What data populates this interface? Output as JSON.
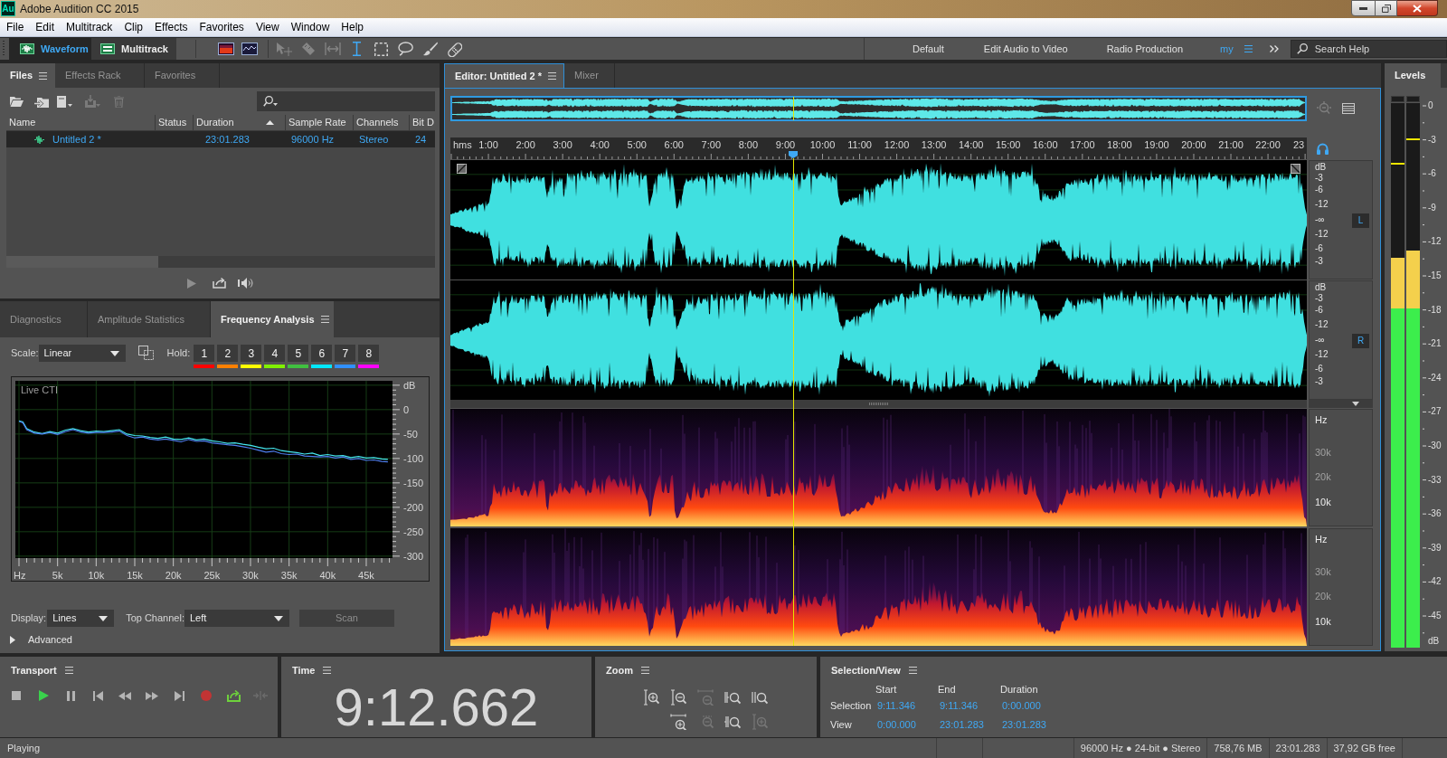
{
  "window": {
    "app_icon": "Au",
    "title": "Adobe Audition CC 2015"
  },
  "menu": [
    "File",
    "Edit",
    "Multitrack",
    "Clip",
    "Effects",
    "Favorites",
    "View",
    "Window",
    "Help"
  ],
  "toolbar": {
    "modes": [
      {
        "label": "Waveform",
        "selected": true
      },
      {
        "label": "Multitrack",
        "selected": false
      }
    ],
    "tools": [
      {
        "selected": false,
        "disabled": true
      },
      {
        "selected": false,
        "disabled": true
      },
      {
        "selected": false,
        "disabled": true
      },
      {
        "selected": true,
        "disabled": false
      },
      {
        "selected": false,
        "disabled": false
      },
      {
        "selected": false,
        "disabled": false
      },
      {
        "selected": false,
        "disabled": false
      },
      {
        "selected": false,
        "disabled": false
      }
    ],
    "workspaces": [
      {
        "label": "Default",
        "selected": false
      },
      {
        "label": "Edit Audio to Video",
        "selected": false
      },
      {
        "label": "Radio Production",
        "selected": false
      },
      {
        "label": "my",
        "selected": true
      }
    ],
    "search": {
      "placeholder": "Search Help"
    }
  },
  "files_panel": {
    "tabs": [
      {
        "label": "Files",
        "selected": true
      },
      {
        "label": "Effects Rack",
        "selected": false
      },
      {
        "label": "Favorites",
        "selected": false
      }
    ],
    "actions": [
      {
        "disabled": false
      },
      {
        "disabled": false
      },
      {
        "disabled": false
      },
      {
        "disabled": true
      },
      {
        "disabled": true
      }
    ],
    "columns": [
      {
        "label": "Name",
        "sorted": false
      },
      {
        "label": "Status",
        "sorted": false
      },
      {
        "label": "Duration",
        "sorted": true
      },
      {
        "label": "Sample Rate",
        "sorted": false
      },
      {
        "label": "Channels",
        "sorted": false
      },
      {
        "label": "Bit D",
        "sorted": false
      }
    ],
    "rows": [
      {
        "selected": true,
        "name": "Untitled 2 *",
        "duration": "23:01.283",
        "sample_rate": "96000 Hz",
        "channels": "Stereo",
        "column_6": "24"
      }
    ]
  },
  "analysis_panel": {
    "tabs": [
      {
        "label": "Diagnostics",
        "selected": false
      },
      {
        "label": "Amplitude Statistics",
        "selected": false
      },
      {
        "label": "Frequency Analysis",
        "selected": true
      }
    ],
    "scale": {
      "label": "Scale:",
      "value": "Linear"
    },
    "hold": {
      "label": "Hold:",
      "buttons": [
        {
          "label": "1",
          "color": "#ff0000"
        },
        {
          "label": "2",
          "color": "#ff8000"
        },
        {
          "label": "3",
          "color": "#ffff00"
        },
        {
          "label": "4",
          "color": "#80f000"
        },
        {
          "label": "5",
          "color": "#40c040"
        },
        {
          "label": "6",
          "color": "#00e8ff"
        },
        {
          "label": "7",
          "color": "#3090ff"
        },
        {
          "label": "8",
          "color": "#ff00ff"
        }
      ]
    },
    "chart_label": "Live CTI",
    "chart_data": {
      "type": "line",
      "xlabel": "Hz",
      "ylabel": "dB",
      "x": [
        0,
        500,
        1000,
        2000,
        3000,
        4000,
        5000,
        6000,
        7000,
        8000,
        9000,
        10000,
        11000,
        12000,
        13000,
        14000,
        15000,
        16000,
        17000,
        18000,
        19000,
        20000,
        21000,
        22000,
        23000,
        24000,
        25000,
        26000,
        27000,
        28000,
        29000,
        30000,
        31000,
        32000,
        33000,
        34000,
        35000,
        36000,
        37000,
        38000,
        39000,
        40000,
        41000,
        42000,
        43000,
        44000,
        45000,
        46000,
        47000,
        47800
      ],
      "series": [
        {
          "color": "#45e6ee",
          "values": [
            -23,
            -25,
            -39,
            -46,
            -49,
            -45,
            -48,
            -42,
            -39,
            -43,
            -46,
            -44,
            -45,
            -43,
            -41,
            -50,
            -53,
            -54,
            -57,
            -59,
            -56,
            -60,
            -61,
            -58,
            -62,
            -60,
            -64,
            -66,
            -69,
            -68,
            -71,
            -73,
            -77,
            -80,
            -79,
            -84,
            -86,
            -88,
            -91,
            -89,
            -94,
            -92,
            -95,
            -94,
            -98,
            -96,
            -99,
            -98,
            -101,
            -102
          ]
        },
        {
          "color": "#4f7ff0",
          "values": [
            -24,
            -27,
            -41,
            -48,
            -50,
            -47,
            -51,
            -45,
            -41,
            -46,
            -48,
            -47,
            -47,
            -46,
            -44,
            -53,
            -58,
            -56,
            -60,
            -62,
            -60,
            -63,
            -66,
            -61,
            -65,
            -64,
            -68,
            -70,
            -72,
            -73,
            -76,
            -79,
            -83,
            -87,
            -85,
            -90,
            -92,
            -91,
            -95,
            -96,
            -97,
            -96,
            -99,
            -97,
            -102,
            -100,
            -104,
            -103,
            -106,
            -107
          ]
        }
      ],
      "xlim": [
        -470,
        48400
      ],
      "ylim": [
        -304,
        59
      ],
      "xticks": [
        {
          "value": 5000,
          "label": "5k"
        },
        {
          "value": 10000,
          "label": "10k"
        },
        {
          "value": 15000,
          "label": "15k"
        },
        {
          "value": 20000,
          "label": "20k"
        },
        {
          "value": 25000,
          "label": "25k"
        },
        {
          "value": 30000,
          "label": "30k"
        },
        {
          "value": 35000,
          "label": "35k"
        },
        {
          "value": 40000,
          "label": "40k"
        },
        {
          "value": 45000,
          "label": "45k"
        }
      ],
      "yticks": [
        0,
        -50,
        -100,
        -150,
        -200,
        -250,
        -300
      ],
      "grid": true
    },
    "display": {
      "label": "Display:",
      "value": "Lines"
    },
    "top_channel": {
      "label": "Top Channel:",
      "value": "Left"
    },
    "scan": {
      "label": "Scan",
      "disabled": true
    },
    "advanced": {
      "label": "Advanced",
      "expanded": false
    }
  },
  "editor": {
    "tabs": [
      {
        "label": "Editor: Untitled 2 *",
        "selected": true
      },
      {
        "label": "Mixer",
        "selected": false
      }
    ],
    "ruler": {
      "unit": "hms",
      "labels": [
        "1:00",
        "2:00",
        "3:00",
        "4:00",
        "5:00",
        "6:00",
        "7:00",
        "8:00",
        "9:00",
        "10:00",
        "11:00",
        "12:00",
        "13:00",
        "14:00",
        "15:00",
        "16:00",
        "17:00",
        "18:00",
        "19:00",
        "20:00",
        "21:00",
        "22:00",
        "23"
      ]
    },
    "playhead": {
      "level": 0.4
    },
    "channels": [
      {
        "label": "L",
        "scale": [
          "dB",
          "-3",
          "-6",
          "-12",
          "-∞",
          "-12",
          "-6",
          "-3"
        ],
        "spectral_scale": [
          "Hz",
          "30k",
          "20k",
          "10k"
        ]
      },
      {
        "label": "R",
        "scale": [
          "dB",
          "-3",
          "-6",
          "-12",
          "-∞",
          "-12",
          "-6",
          "-3"
        ],
        "spectral_scale": [
          "Hz",
          "30k",
          "20k",
          "10k"
        ]
      }
    ]
  },
  "levels_panel": {
    "tab": "Levels",
    "meters": [
      {
        "level": 0.716,
        "peak_hold": {
          "level": 0.887
        }
      },
      {
        "level": 0.729,
        "peak_hold": {
          "level": 0.932
        }
      }
    ],
    "scale": [
      "0",
      "-3",
      "-6",
      "-9",
      "-12",
      "-15",
      "-18",
      "-21",
      "-24",
      "-27",
      "-30",
      "-33",
      "-36",
      "-39",
      "-42",
      "-45",
      "dB"
    ]
  },
  "transport": {
    "title": "Transport",
    "buttons": [
      {
        "disabled": false
      },
      {
        "disabled": false
      },
      {
        "disabled": false
      },
      {
        "disabled": false
      },
      {
        "disabled": false
      },
      {
        "disabled": false
      },
      {
        "disabled": false
      },
      {
        "disabled": false
      },
      {
        "disabled": false
      },
      {
        "disabled": true
      }
    ]
  },
  "time": {
    "title": "Time",
    "value": "9:12.662"
  },
  "zoom": {
    "title": "Zoom",
    "buttons": [
      {
        "disabled": false
      },
      {
        "disabled": false
      },
      {
        "disabled": true
      },
      {
        "disabled": false
      },
      {
        "disabled": false
      },
      {
        "disabled": false
      },
      {
        "disabled": true
      },
      {
        "disabled": false
      },
      {
        "disabled": true
      }
    ]
  },
  "selection_view": {
    "title": "Selection/View",
    "headers": [
      "Start",
      "End",
      "Duration"
    ],
    "rows": [
      {
        "label": "Selection",
        "values": [
          "9:11.346",
          "9:11.346",
          "0:00.000"
        ]
      },
      {
        "label": "View",
        "values": [
          "0:00.000",
          "23:01.283",
          "23:01.283"
        ]
      }
    ]
  },
  "status_bar": {
    "state": "Playing",
    "fields": [
      "96000 Hz ● 24-bit ● Stereo",
      "758,76 MB",
      "23:01.283",
      "37,92 GB free"
    ]
  }
}
